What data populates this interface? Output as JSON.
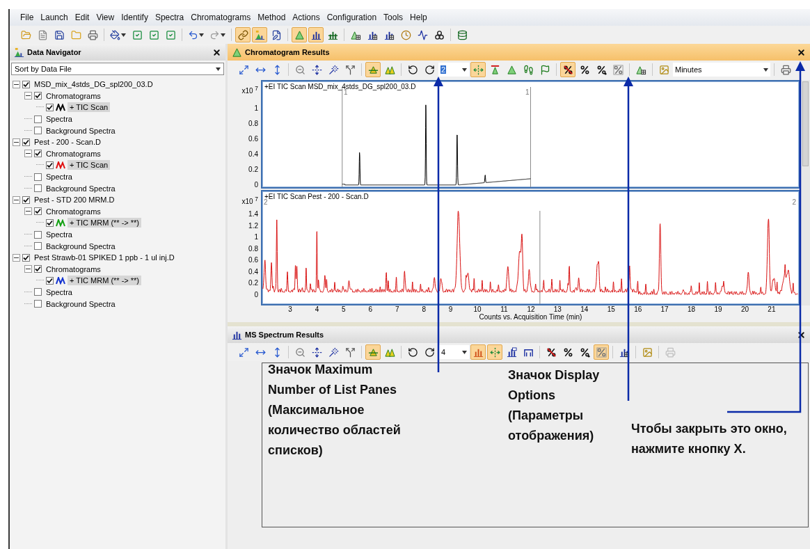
{
  "menu": [
    "File",
    "Launch",
    "Edit",
    "View",
    "Identify",
    "Spectra",
    "Chromatograms",
    "Method",
    "Actions",
    "Configuration",
    "Tools",
    "Help"
  ],
  "main_toolbar": [
    {
      "pressed": false
    },
    {
      "pressed": false
    },
    {
      "pressed": false
    },
    {
      "pressed": false
    },
    {
      "pressed": false
    },
    {
      "pressed": false
    },
    {
      "pressed": false
    },
    {
      "pressed": false
    },
    {
      "pressed": false
    },
    {
      "pressed": false
    },
    {
      "pressed": false
    },
    {
      "pressed": true
    },
    {
      "pressed": true
    },
    {
      "pressed": false
    },
    {
      "pressed": true
    },
    {
      "pressed": true
    },
    {
      "pressed": false
    },
    {
      "pressed": false
    },
    {
      "pressed": false
    },
    {
      "pressed": false
    },
    {
      "pressed": false
    },
    {
      "pressed": false
    },
    {
      "pressed": false
    },
    {
      "pressed": false
    }
  ],
  "data_navigator": {
    "title": "Data Navigator",
    "sort": "Sort by Data File",
    "files": [
      {
        "label": "MSD_mix_4stds_DG_spl200_03.D",
        "checked": true,
        "expanded": true,
        "selected": false,
        "children": [
          {
            "label": "Chromatograms",
            "checked": true,
            "expanded": true,
            "selected": false,
            "children": [
              {
                "label": "+ TIC Scan",
                "checked": true,
                "selected": true,
                "color": "#000000"
              }
            ]
          },
          {
            "label": "Spectra",
            "checked": false,
            "selected": false
          },
          {
            "label": "Background Spectra",
            "checked": false,
            "selected": false
          }
        ]
      },
      {
        "label": "Pest - 200 - Scan.D",
        "checked": true,
        "expanded": true,
        "selected": false,
        "children": [
          {
            "label": "Chromatograms",
            "checked": true,
            "expanded": true,
            "selected": false,
            "children": [
              {
                "label": "+ TIC Scan",
                "checked": true,
                "selected": true,
                "color": "#e01010"
              }
            ]
          },
          {
            "label": "Spectra",
            "checked": false,
            "selected": false
          },
          {
            "label": "Background Spectra",
            "checked": false,
            "selected": false
          }
        ]
      },
      {
        "label": "Pest - STD 200 MRM.D",
        "checked": true,
        "expanded": true,
        "selected": false,
        "children": [
          {
            "label": "Chromatograms",
            "checked": true,
            "expanded": true,
            "selected": false,
            "children": [
              {
                "label": "+ TIC MRM (** -> **)",
                "checked": true,
                "selected": true,
                "color": "#10a010"
              }
            ]
          },
          {
            "label": "Spectra",
            "checked": false,
            "selected": false
          },
          {
            "label": "Background Spectra",
            "checked": false,
            "selected": false
          }
        ]
      },
      {
        "label": "Pest Strawb-01 SPIKED 1 ppb - 1 ul inj.D",
        "checked": true,
        "expanded": true,
        "selected": false,
        "children": [
          {
            "label": "Chromatograms",
            "checked": true,
            "expanded": true,
            "selected": false,
            "children": [
              {
                "label": "+ TIC MRM (** -> **)",
                "checked": true,
                "selected": true,
                "color": "#1030d0"
              }
            ]
          },
          {
            "label": "Spectra",
            "checked": false,
            "selected": false
          },
          {
            "label": "Background Spectra",
            "checked": false,
            "selected": false
          }
        ]
      }
    ]
  },
  "chromatogram_results": {
    "title": "Chromatogram Results",
    "toolbar": [
      {
        "pressed": false
      },
      {
        "pressed": false
      },
      {
        "pressed": false
      },
      {
        "pressed": false
      },
      {
        "pressed": false
      },
      {
        "pressed": false
      },
      {
        "pressed": false
      },
      {
        "pressed": true
      },
      {
        "pressed": false
      },
      {
        "pressed": false
      },
      {
        "pressed": false
      },
      {
        "pressed": true
      },
      {
        "pressed": false
      },
      {
        "pressed": false
      },
      {
        "pressed": false
      },
      {
        "pressed": false
      },
      {
        "pressed": true
      },
      {
        "pressed": false
      },
      {
        "pressed": false
      },
      {
        "pressed": false
      },
      {
        "pressed": false
      },
      {
        "pressed": false
      },
      {
        "pressed": false
      }
    ],
    "panes": {
      "value": "2",
      "highlighted": true
    },
    "time_units": "Minutes",
    "plots": [
      {
        "title": "+EI TIC Scan MSD_mix_4stds_DG_spl200_03.D",
        "multiplier": "x10 $^{7}$",
        "y_ticks": [
          "1",
          "0.8",
          "0.6",
          "0.4",
          "0.2",
          "0"
        ],
        "markers": [
          "1",
          "1"
        ],
        "color": "#000000"
      },
      {
        "title": "+EI TIC Scan Pest - 200 - Scan.D",
        "multiplier": "x10 $^{7}$",
        "y_ticks": [
          "1.4",
          "1.2",
          "1",
          "0.8",
          "0.6",
          "0.4",
          "0.2",
          "0"
        ],
        "markers": [
          "2",
          "2"
        ],
        "color": "#d81010"
      }
    ],
    "x_ticks": [
      "3",
      "4",
      "5",
      "6",
      "7",
      "8",
      "9",
      "10",
      "11",
      "12",
      "13",
      "14",
      "15",
      "16",
      "17",
      "18",
      "19",
      "20",
      "21"
    ],
    "x_label": "Counts vs. Acquisition Time (min)"
  },
  "ms_spectrum_results": {
    "title": "MS Spectrum Results",
    "toolbar": [
      {
        "pressed": false,
        "disabled": false
      },
      {
        "pressed": false,
        "disabled": false
      },
      {
        "pressed": false,
        "disabled": false
      },
      {
        "pressed": false,
        "disabled": false
      },
      {
        "pressed": false,
        "disabled": false
      },
      {
        "pressed": false,
        "disabled": false
      },
      {
        "pressed": false,
        "disabled": false
      },
      {
        "pressed": true,
        "disabled": false
      },
      {
        "pressed": false,
        "disabled": false
      },
      {
        "pressed": false,
        "disabled": false
      },
      {
        "pressed": false,
        "disabled": false
      },
      {
        "pressed": true,
        "disabled": false
      },
      {
        "pressed": true,
        "disabled": false
      },
      {
        "pressed": false,
        "disabled": false
      },
      {
        "pressed": false,
        "disabled": false
      },
      {
        "pressed": false,
        "disabled": false
      },
      {
        "pressed": false,
        "disabled": false
      },
      {
        "pressed": false,
        "disabled": false
      },
      {
        "pressed": true,
        "disabled": false
      },
      {
        "pressed": false,
        "disabled": false
      },
      {
        "pressed": false,
        "disabled": false
      },
      {
        "pressed": false,
        "disabled": true
      }
    ],
    "panes": {
      "value": "4",
      "highlighted": false
    }
  },
  "annotations": [
    {
      "text": "Значок Maximum Number of List Panes (Максимальное количество областей списков)"
    },
    {
      "text": "Значок Display Options (Параметры отображения)"
    },
    {
      "text": "Чтобы закрыть это окно, нажмите кнопку X."
    }
  ]
}
